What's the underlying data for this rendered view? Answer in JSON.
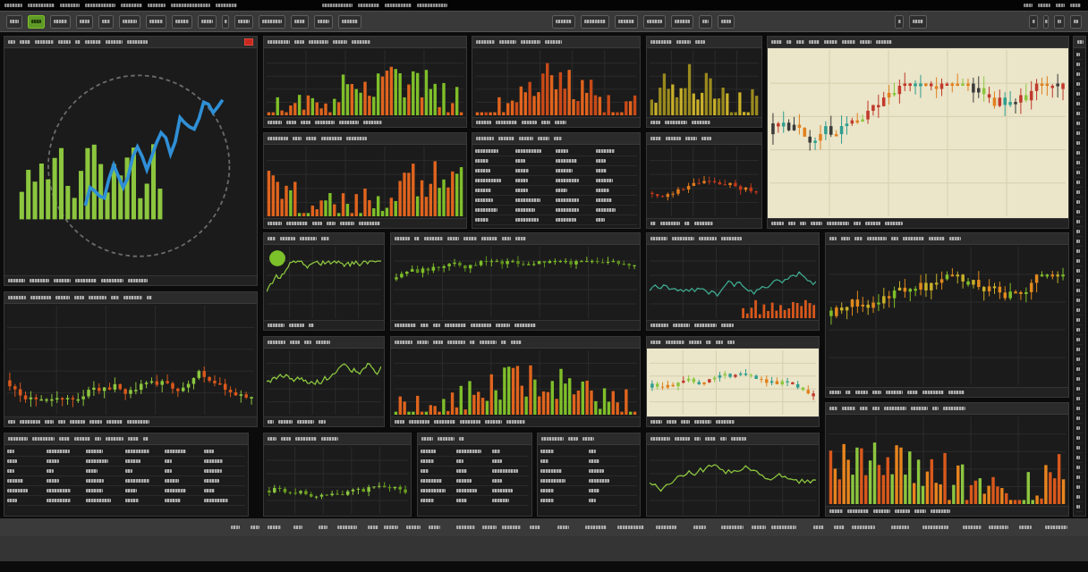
{
  "toolbar": {
    "left": [
      {
        "selected": false
      },
      {
        "selected": true
      },
      {
        "selected": false
      },
      {
        "selected": false
      },
      {
        "selected": false
      },
      {
        "selected": false
      },
      {
        "selected": false
      },
      {
        "selected": false
      },
      {
        "selected": false
      },
      {
        "selected": false
      },
      {
        "selected": false
      },
      {
        "selected": false
      },
      {
        "selected": false
      },
      {
        "selected": false
      },
      {
        "selected": false
      }
    ],
    "middle": [
      {
        "selected": false
      },
      {
        "selected": false
      },
      {
        "selected": false
      },
      {
        "selected": false
      },
      {
        "selected": false
      },
      {
        "selected": false
      },
      {
        "selected": false
      }
    ],
    "center_right": [
      {
        "selected": false
      },
      {
        "selected": false
      }
    ],
    "right": [
      {
        "selected": false
      },
      {
        "selected": false
      },
      {
        "selected": false
      },
      {
        "selected": false
      }
    ]
  },
  "panels": [
    {
      "kind": "ring",
      "light": false,
      "indicator": false,
      "alert": true
    },
    {
      "kind": "candles",
      "light": false,
      "indicator": false,
      "alert": false
    },
    {
      "kind": "table",
      "light": false,
      "indicator": false,
      "alert": false
    },
    {
      "kind": "bars",
      "light": false,
      "indicator": false,
      "alert": false
    },
    {
      "kind": "bars",
      "light": false,
      "indicator": false,
      "alert": false
    },
    {
      "kind": "bars",
      "light": false,
      "indicator": false,
      "alert": false
    },
    {
      "kind": "candles",
      "light": true,
      "indicator": false,
      "alert": false
    },
    {
      "kind": "table",
      "light": false,
      "indicator": false,
      "alert": false
    },
    {
      "kind": "bars",
      "light": false,
      "indicator": false,
      "alert": false
    },
    {
      "kind": "table",
      "light": false,
      "indicator": false,
      "alert": false
    },
    {
      "kind": "candles",
      "light": false,
      "indicator": false,
      "alert": false
    },
    {
      "kind": "line",
      "light": false,
      "indicator": true,
      "alert": false
    },
    {
      "kind": "candles",
      "light": false,
      "indicator": false,
      "alert": false
    },
    {
      "kind": "line",
      "light": false,
      "indicator": false,
      "alert": false
    },
    {
      "kind": "candles",
      "light": false,
      "indicator": false,
      "alert": false
    },
    {
      "kind": "line",
      "light": false,
      "indicator": false,
      "alert": false
    },
    {
      "kind": "bars",
      "light": false,
      "indicator": false,
      "alert": false
    },
    {
      "kind": "candles",
      "light": true,
      "indicator": false,
      "alert": false
    },
    {
      "kind": "bars",
      "light": false,
      "indicator": false,
      "alert": false
    },
    {
      "kind": "candles",
      "light": false,
      "indicator": false,
      "alert": false
    },
    {
      "kind": "table",
      "light": false,
      "indicator": false,
      "alert": false
    },
    {
      "kind": "table",
      "light": false,
      "indicator": false,
      "alert": false
    },
    {
      "kind": "line",
      "light": false,
      "indicator": false,
      "alert": false
    }
  ]
}
